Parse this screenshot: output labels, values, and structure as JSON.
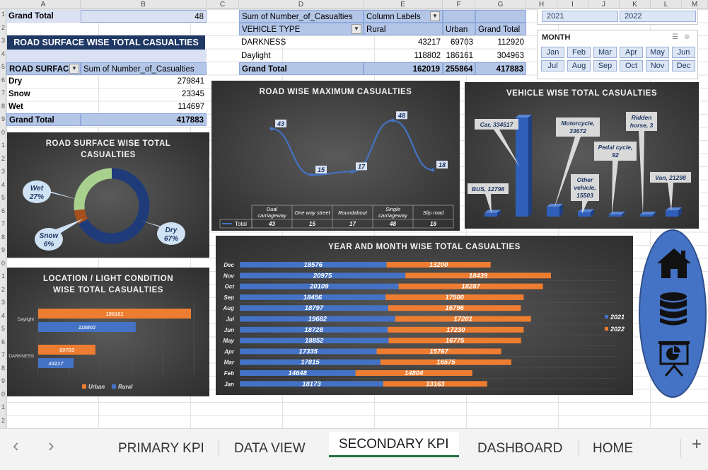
{
  "col_headers": [
    "A",
    "B",
    "C",
    "D",
    "E",
    "F",
    "G",
    "H",
    "I",
    "J",
    "K",
    "L",
    "M"
  ],
  "row_headers": [
    "1",
    "2",
    "3",
    "4",
    "5",
    "6",
    "7",
    "8",
    "9",
    "0",
    "1",
    "2",
    "3",
    "4",
    "5",
    "6",
    "7",
    "8",
    "9",
    "0",
    "1",
    "2",
    "3",
    "4",
    "5",
    "6",
    "7",
    "8",
    "9",
    "0",
    "1",
    "2"
  ],
  "grand_total_top": {
    "label": "Grand Total",
    "value": "48"
  },
  "road_surface_table": {
    "title": "ROAD SURFACE WISE TOTAL CASUALTIES",
    "col1": "ROAD SURFACE",
    "col2": "Sum of Number_of_Casualties",
    "rows": [
      {
        "label": "Dry",
        "value": "279841"
      },
      {
        "label": "Snow",
        "value": "23345"
      },
      {
        "label": "Wet",
        "value": "114697"
      }
    ],
    "total": {
      "label": "Grand Total",
      "value": "417883"
    }
  },
  "vehicle_type_table": {
    "h1": "Sum of Number_of_Casualties",
    "h2": "Column Labels",
    "c1": "VEHICLE TYPE",
    "c2": "Rural",
    "c3": "Urban",
    "c4": "Grand Total",
    "rows": [
      {
        "label": "DARKNESS",
        "rural": "43217",
        "urban": "69703",
        "total": "112920"
      },
      {
        "label": "Daylight",
        "rural": "118802",
        "urban": "186161",
        "total": "304963"
      }
    ],
    "total": {
      "label": "Grand Total",
      "rural": "162019",
      "urban": "255864",
      "total": "417883"
    }
  },
  "year_slicer": {
    "items": [
      "2021",
      "2022"
    ]
  },
  "month_slicer": {
    "title": "MONTH",
    "items": [
      "Jan",
      "Feb",
      "Mar",
      "Apr",
      "May",
      "Jun",
      "Jul",
      "Aug",
      "Sep",
      "Oct",
      "Nov",
      "Dec"
    ]
  },
  "chart_data": [
    {
      "type": "pie",
      "title": "ROAD SURFACE WISE TOTAL CASUALTIES",
      "categories": [
        "Dry",
        "Snow",
        "Wet"
      ],
      "values": [
        67,
        6,
        27
      ],
      "labels": [
        "Dry\n67%",
        "Snow\n6%",
        "Wet\n27%"
      ],
      "colors": [
        "#1f3b7a",
        "#a5501c",
        "#a9d18e"
      ]
    },
    {
      "type": "line",
      "title": "ROAD WISE MAXIMUM CASUALTIES",
      "categories": [
        "Dual carriageway",
        "One way street",
        "Roundabout",
        "Single carriageway",
        "Slip road"
      ],
      "series": [
        {
          "name": "Total",
          "values": [
            43,
            15,
            17,
            48,
            18
          ]
        }
      ],
      "legend": "bottom-table",
      "color": "#4472c4"
    },
    {
      "type": "bar",
      "title": "VEHICLE WISE TOTAL CASUALTIES",
      "categories": [
        "BUS",
        "Car",
        "Motorcycle",
        "Other vehicle",
        "Pedal cycle",
        "Ridden horse",
        "Van"
      ],
      "values": [
        12798,
        334517,
        33672,
        15503,
        92,
        3,
        21298
      ],
      "labels": [
        "BUS, 12798",
        "Car, 334517",
        "Motorcycle, 33672",
        "Other vehicle, 15503",
        "Pedal cycle, 92",
        "Ridden horse, 3",
        "Van, 21298"
      ],
      "color": "#2f5fb8"
    },
    {
      "type": "bar",
      "orientation": "horizontal",
      "title": "LOCATION / LIGHT CONDITION WISE TOTAL CASUALTIES",
      "categories": [
        "DARKNESS",
        "Daylight"
      ],
      "series": [
        {
          "name": "Rural",
          "values": [
            43217,
            118802
          ],
          "color": "#4472c4"
        },
        {
          "name": "Urban",
          "values": [
            69703,
            186161
          ],
          "color": "#ed7d31"
        }
      ],
      "legend": "bottom"
    },
    {
      "type": "bar",
      "orientation": "horizontal",
      "stacked": true,
      "title": "YEAR AND MONTH WISE TOTAL CASUALTIES",
      "categories": [
        "Jan",
        "Feb",
        "Mar",
        "Apr",
        "May",
        "Jun",
        "Jul",
        "Aug",
        "Sep",
        "Oct",
        "Nov",
        "Dec"
      ],
      "series": [
        {
          "name": "2021",
          "values": [
            18173,
            14648,
            17815,
            17335,
            18852,
            18728,
            19682,
            18797,
            18456,
            20109,
            20975,
            18576
          ],
          "color": "#4472c4"
        },
        {
          "name": "2022",
          "values": [
            13163,
            14804,
            16575,
            15767,
            16775,
            17230,
            17201,
            16796,
            17500,
            18287,
            18439,
            13200
          ],
          "color": "#ed7d31"
        }
      ],
      "legend": "right"
    }
  ],
  "nav_icons": [
    {
      "name": "home-icon"
    },
    {
      "name": "database-icon"
    },
    {
      "name": "presentation-chart-icon"
    }
  ],
  "sheet_tabs": {
    "prev": "‹",
    "next": "›",
    "items": [
      "PRIMARY KPI",
      "DATA VIEW",
      "SECONDARY KPI",
      "DASHBOARD",
      "HOME"
    ],
    "active": "SECONDARY KPI",
    "add": "+"
  }
}
